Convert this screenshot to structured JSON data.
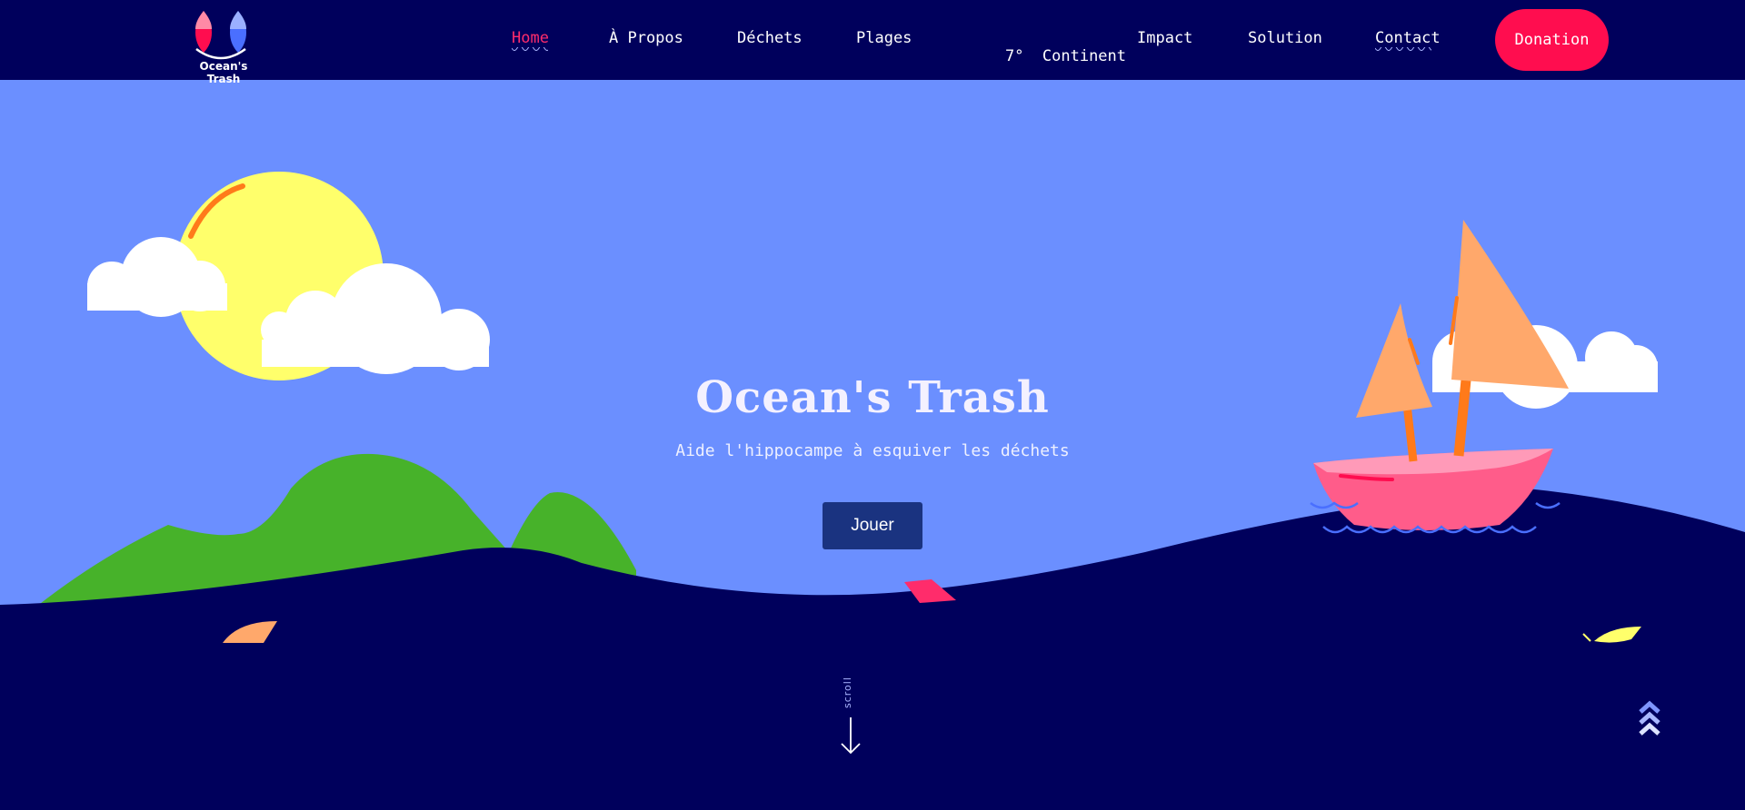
{
  "brand": {
    "name": "Ocean's Trash"
  },
  "nav": {
    "items": [
      {
        "label": "Home",
        "active": true
      },
      {
        "label": "À Propos"
      },
      {
        "label": "Déchets"
      },
      {
        "label": "Plages"
      },
      {
        "label": "7°  Continent"
      },
      {
        "label": "Impact"
      },
      {
        "label": "Solution"
      },
      {
        "label": "Contact",
        "underline": true
      }
    ],
    "donate_label": "Donation"
  },
  "hero": {
    "title": "Ocean's Trash",
    "subtitle": "Aide l'hippocampe à esquiver les déchets",
    "play_label": "Jouer"
  },
  "scroll": {
    "label": "scroll"
  },
  "colors": {
    "nav_bg": "#00005c",
    "sky": "#6b8fff",
    "sea": "#00005c",
    "accent": "#ff0d4f",
    "active_link": "#ff2c6b",
    "sun": "#ffff6b",
    "hills": "#47b22a",
    "boat_hull": "#ff5c8a",
    "sail": "#ffa86b",
    "button": "#1a3380"
  },
  "icons": {
    "logo": "fish-pair-logo",
    "scroll": "arrow-down-icon",
    "back_to_top": "chevron-triple-up-icon"
  }
}
